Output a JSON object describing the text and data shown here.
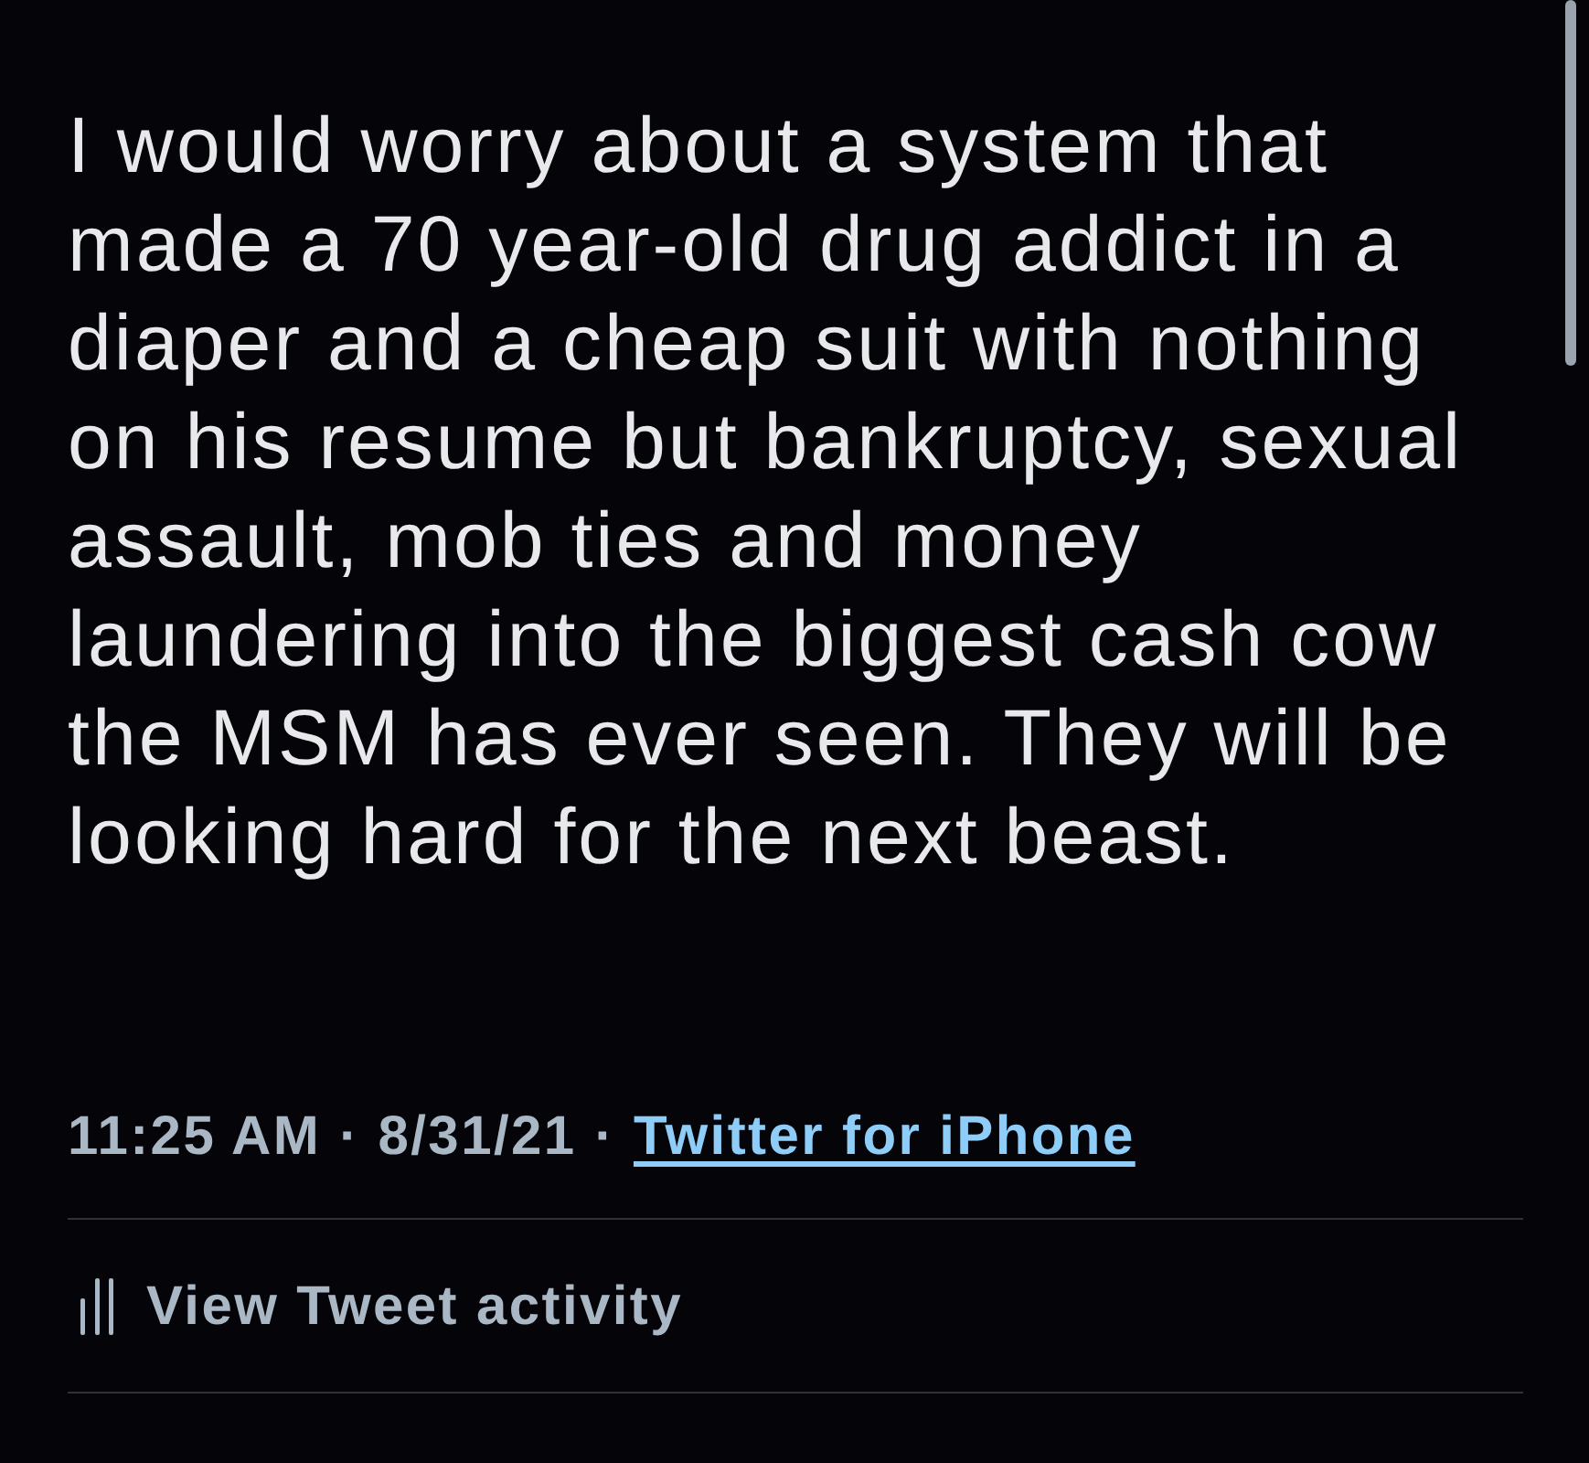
{
  "tweet": {
    "text": "I would worry about a system that made a 70 year-old drug addict in a diaper and a cheap suit with nothing on his resume but bankruptcy, sexual assault, mob ties and money laundering into the biggest cash cow the MSM has ever seen. They will be looking hard for the next beast."
  },
  "meta": {
    "time": "11:25 AM",
    "separator_1": "·",
    "date": "8/31/21",
    "separator_2": "·",
    "source": "Twitter for iPhone"
  },
  "activity": {
    "label": "View Tweet activity"
  }
}
